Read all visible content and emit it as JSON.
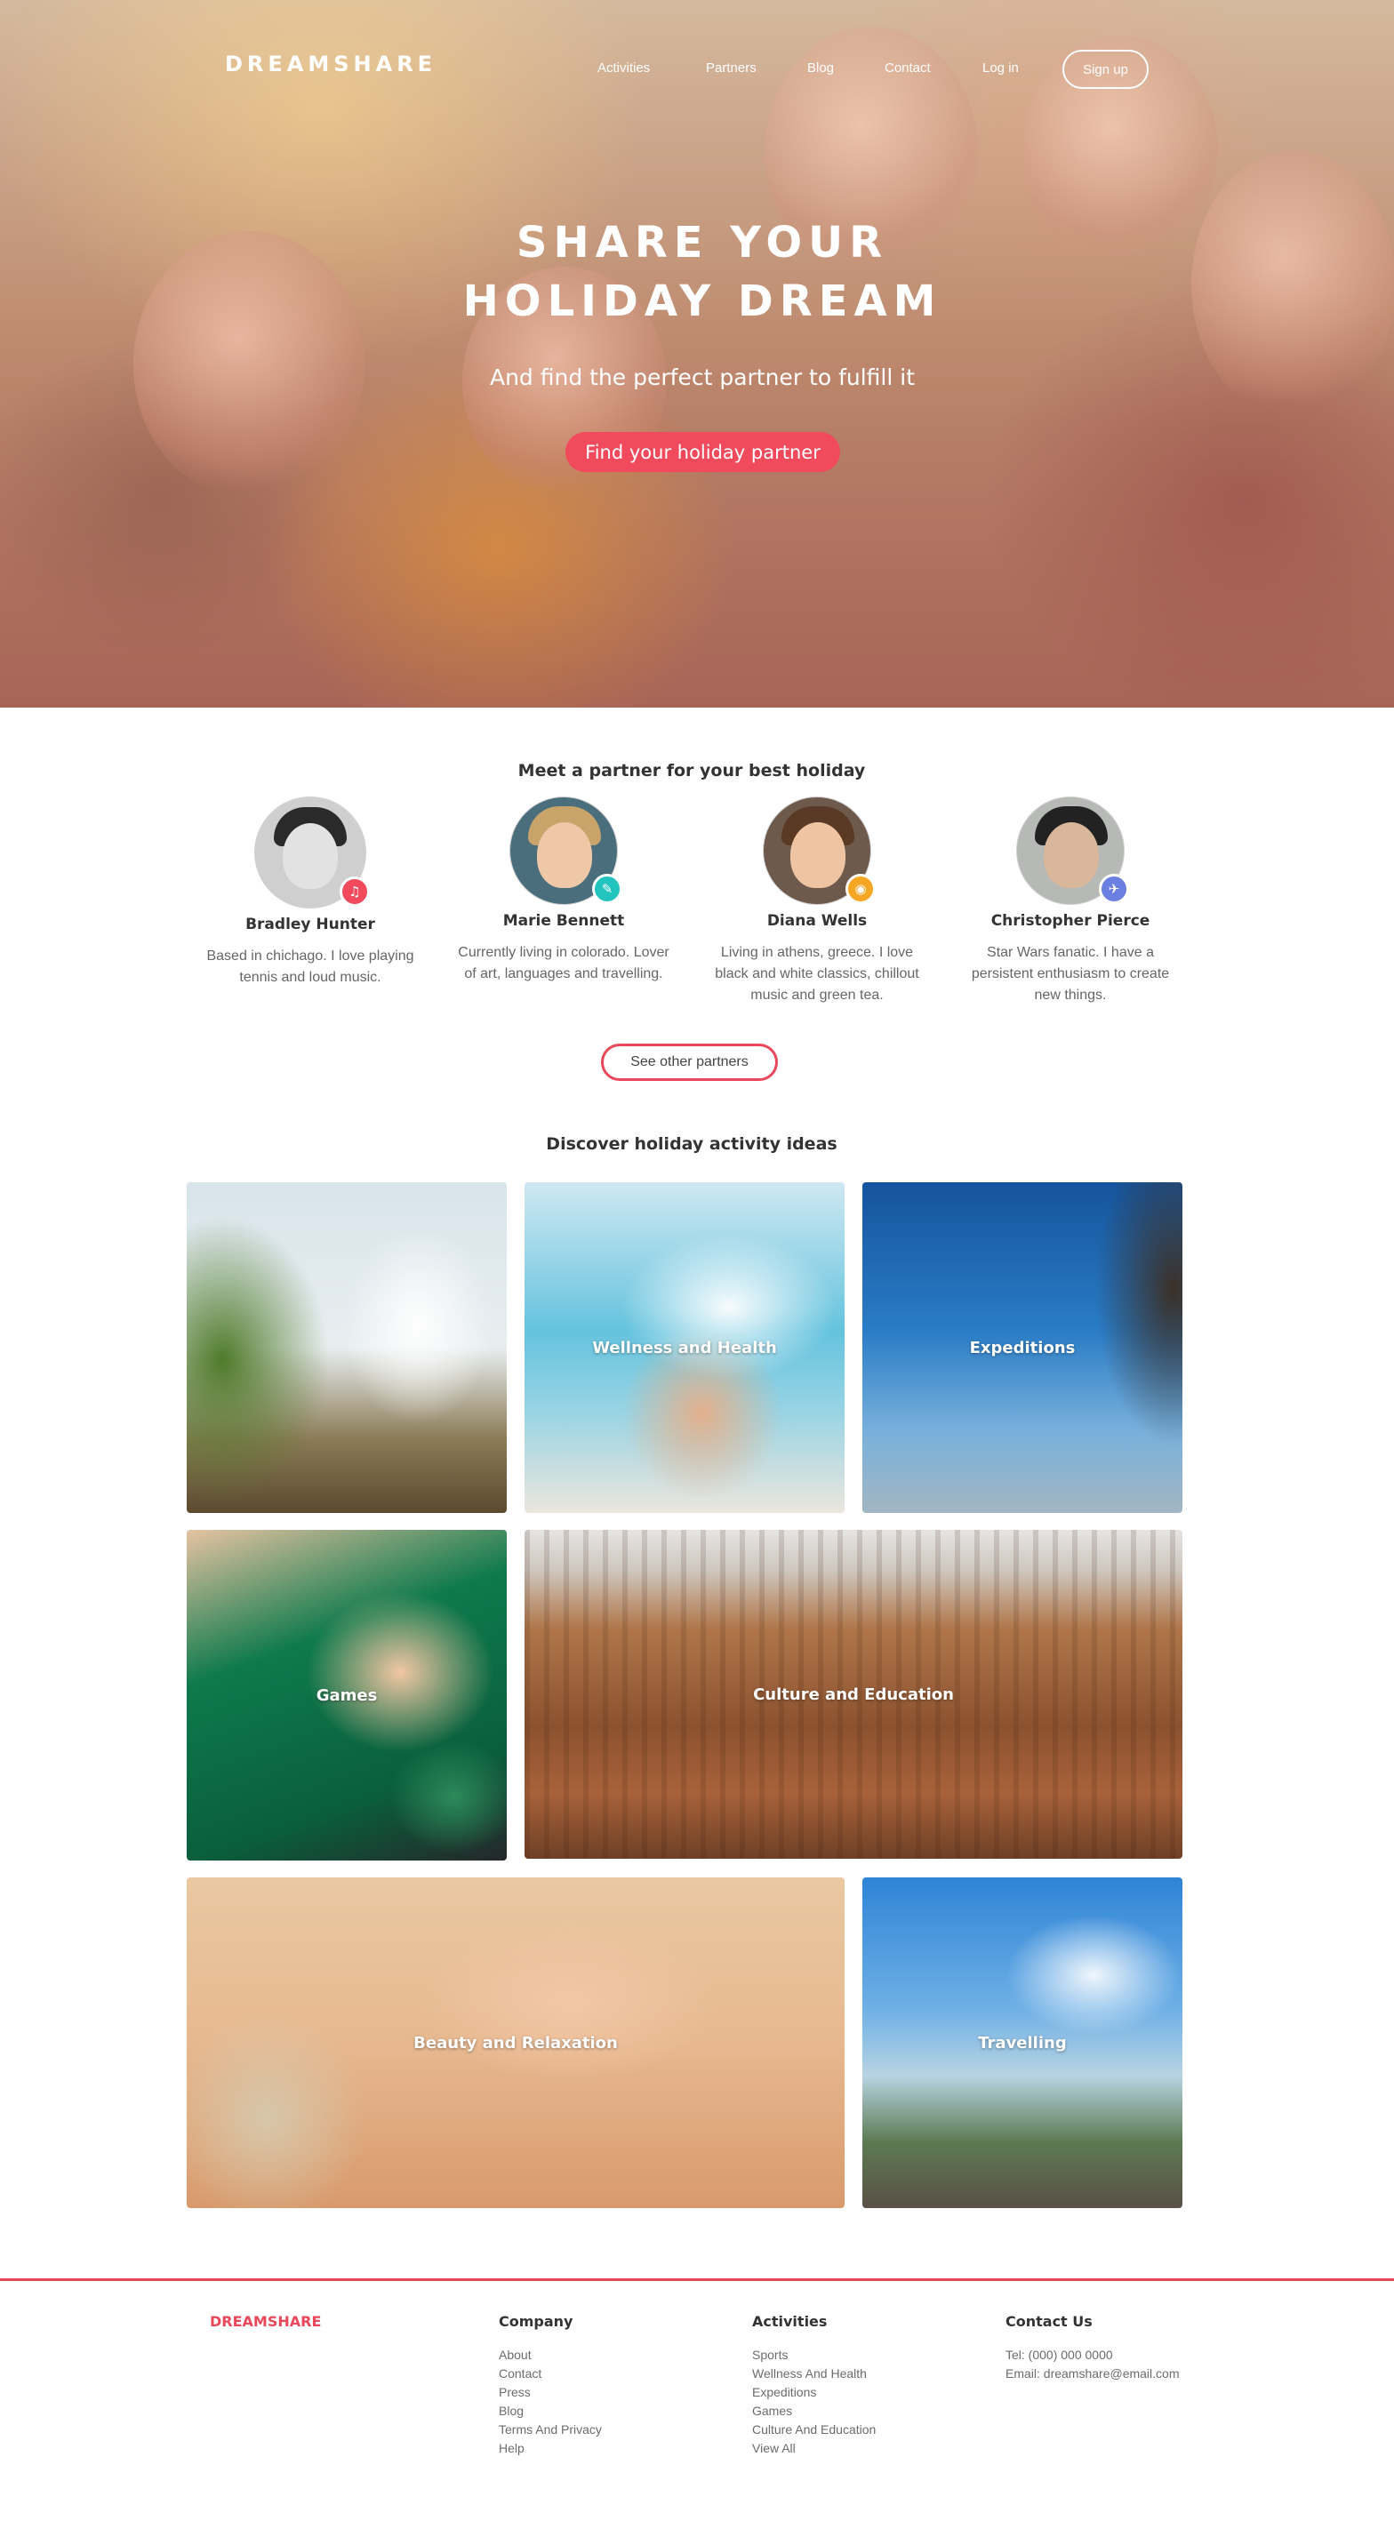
{
  "brand": {
    "name": "DREAMSHARE",
    "accent_color": "#f04a5c"
  },
  "nav": {
    "links": [
      "Activities",
      "Partners",
      "Blog",
      "Contact",
      "Log in"
    ],
    "signup_label": "Sign up"
  },
  "hero": {
    "title_line1": "SHARE YOUR",
    "title_line2": "HOLIDAY DREAM",
    "subtitle": "And find the perfect partner to fulfill it",
    "cta_label": "Find your holiday partner"
  },
  "partners": {
    "heading": "Meet a partner for your best holiday",
    "items": [
      {
        "name": "Bradley Hunter",
        "bio": "Based in chichago. I love playing tennis and loud music.",
        "badge_icon": "music-note-icon",
        "badge_glyph": "♫",
        "badge_color": "#f04a5c"
      },
      {
        "name": "Marie Bennett",
        "bio": "Currently living in colorado. Lover of art, languages and travelling.",
        "badge_icon": "pencil-icon",
        "badge_glyph": "✎",
        "badge_color": "#22c4bd"
      },
      {
        "name": "Diana Wells",
        "bio": "Living in athens, greece. I love black and white classics, chillout music and green tea.",
        "badge_icon": "camera-icon",
        "badge_glyph": "◉",
        "badge_color": "#f5a623"
      },
      {
        "name": "Christopher Pierce",
        "bio": "Star Wars fanatic. I have a persistent enthusiasm to create new things.",
        "badge_icon": "airplane-icon",
        "badge_glyph": "✈",
        "badge_color": "#6b7fe0"
      }
    ],
    "see_more_label": "See other partners"
  },
  "activities": {
    "heading": "Discover holiday activity ideas",
    "tiles": [
      {
        "label": "",
        "kind": "sports"
      },
      {
        "label": "Wellness and Health",
        "kind": "wellness"
      },
      {
        "label": "Expeditions",
        "kind": "expeditions"
      },
      {
        "label": "Games",
        "kind": "games"
      },
      {
        "label": "Culture and Education",
        "kind": "culture"
      },
      {
        "label": "Beauty and Relaxation",
        "kind": "beauty"
      },
      {
        "label": "Travelling",
        "kind": "travelling"
      }
    ]
  },
  "footer": {
    "logo": "DREAMSHARE",
    "company": {
      "heading": "Company",
      "links": [
        "About",
        "Contact",
        "Press",
        "Blog",
        "Terms And Privacy",
        "Help"
      ]
    },
    "activities": {
      "heading": "Activities",
      "links": [
        "Sports",
        "Wellness And Health",
        "Expeditions",
        "Games",
        "Culture And Education",
        "View All"
      ]
    },
    "contact": {
      "heading": "Contact Us",
      "lines": [
        "Tel: (000) 000 0000",
        "Email: dreamshare@email.com"
      ]
    }
  }
}
